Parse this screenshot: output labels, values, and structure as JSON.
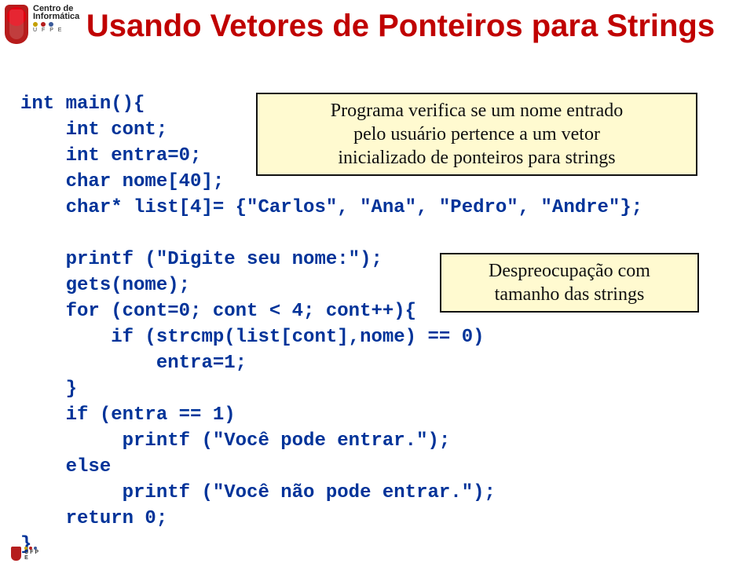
{
  "title": "Usando Vetores de Ponteiros para Strings",
  "callout_top_l1": "Programa verifica se um nome entrado",
  "callout_top_l2": "pelo usuário pertence a um vetor",
  "callout_top_l3": "inicializado de ponteiros para strings",
  "callout_right_l1": "Despreocupação com",
  "callout_right_l2": "tamanho das strings",
  "code": {
    "l01": "int main(){",
    "l02": "    int cont;",
    "l03": "    int entra=0;",
    "l04": "    char nome[40];",
    "l05": "    char* list[4]= {\"Carlos\", \"Ana\", \"Pedro\", \"Andre\"};",
    "l06": "",
    "l07": "    printf (\"Digite seu nome:\");",
    "l08": "    gets(nome);",
    "l09": "    for (cont=0; cont < 4; cont++){",
    "l10": "        if (strcmp(list[cont],nome) == 0)",
    "l11": "            entra=1;",
    "l12": "    }",
    "l13": "    if (entra == 1)",
    "l14": "         printf (\"Você pode entrar.\");",
    "l15": "    else",
    "l16": "         printf (\"Você não pode entrar.\");",
    "l17": "    return 0;",
    "l18": "}"
  },
  "logo": {
    "line1a": "Centro",
    "line1b": "de",
    "line2": "Informática",
    "sub": "U  F  P  E"
  }
}
